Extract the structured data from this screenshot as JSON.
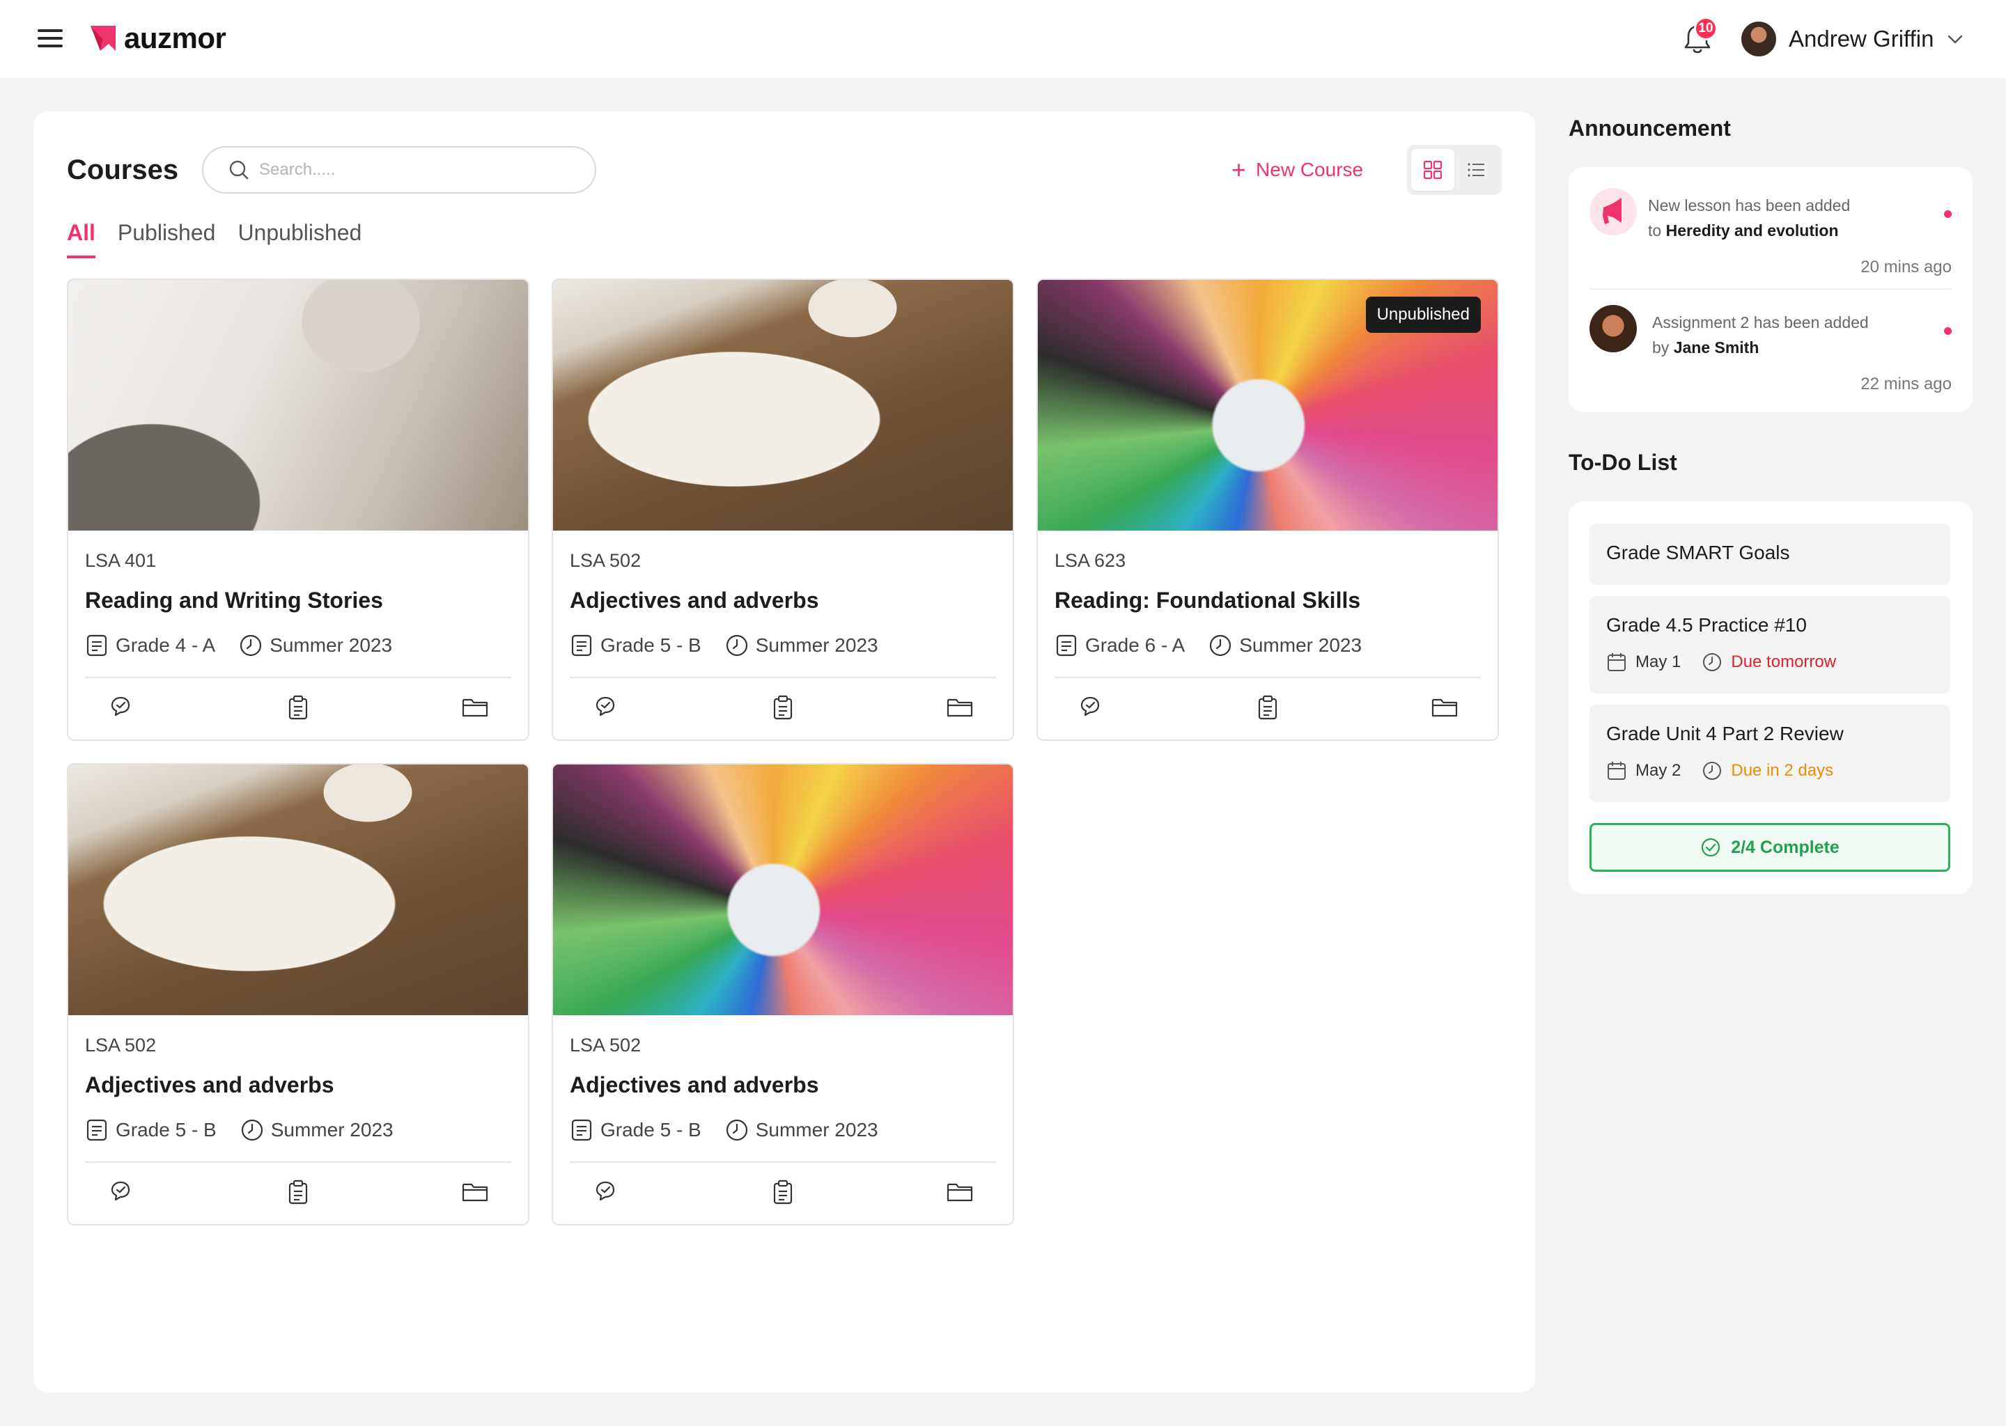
{
  "header": {
    "brand": "auzmor",
    "notification_count": "10",
    "user_name": "Andrew Griffin"
  },
  "courses_panel": {
    "title": "Courses",
    "search_placeholder": "Search.....",
    "new_course_label": "New Course",
    "tabs": [
      {
        "label": "All",
        "active": true
      },
      {
        "label": "Published",
        "active": false
      },
      {
        "label": "Unpublished",
        "active": false
      }
    ],
    "cards": [
      {
        "code": "LSA 401",
        "title": "Reading and Writing Stories",
        "grade": "Grade 4 - A",
        "term": "Summer 2023",
        "image": "writing-photo",
        "badge": ""
      },
      {
        "code": "LSA 502",
        "title": "Adjectives and adverbs",
        "grade": "Grade 5 - B",
        "term": "Summer 2023",
        "image": "open-book-photo",
        "badge": ""
      },
      {
        "code": "LSA 623",
        "title": "Reading: Foundational Skills",
        "grade": "Grade 6 - A",
        "term": "Summer 2023",
        "image": "colored-pencils-photo",
        "badge": "Unpublished"
      },
      {
        "code": "LSA 502",
        "title": "Adjectives and adverbs",
        "grade": "Grade 5 - B",
        "term": "Summer 2023",
        "image": "open-book-photo",
        "badge": ""
      },
      {
        "code": "LSA 502",
        "title": "Adjectives and adverbs",
        "grade": "Grade 5 - B",
        "term": "Summer 2023",
        "image": "colored-pencils-photo",
        "badge": ""
      }
    ]
  },
  "announcement": {
    "title": "Announcement",
    "items": [
      {
        "prefix": "New lesson has been added",
        "connector": "to",
        "highlight": "Heredity and evolution",
        "time": "20 mins ago",
        "icon": "megaphone-icon"
      },
      {
        "prefix": "Assignment 2 has been added",
        "connector": "by",
        "highlight": "Jane Smith",
        "time": "22 mins ago",
        "icon": "avatar"
      }
    ]
  },
  "todo": {
    "title": "To-Do List",
    "items": [
      {
        "title": "Grade SMART Goals",
        "date": "",
        "due": "",
        "due_color": ""
      },
      {
        "title": "Grade 4.5 Practice #10",
        "date": "May 1",
        "due": "Due tomorrow",
        "due_color": "#e0202a"
      },
      {
        "title": "Grade Unit 4 Part 2 Review",
        "date": "May 2",
        "due": "Due in 2 days",
        "due_color": "#f08a00"
      }
    ],
    "complete_label": "2/4 Complete"
  },
  "colors": {
    "accent": "#f0336a",
    "success": "#2cb05a",
    "due_soon": "#e0202a",
    "due_later": "#f08a00"
  }
}
